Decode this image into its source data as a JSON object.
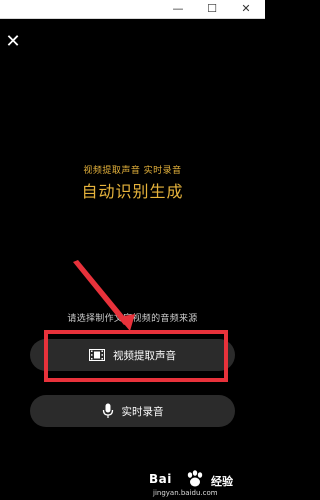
{
  "titlebar": {
    "minimize_glyph": "—",
    "maximize_glyph": "☐",
    "close_glyph": "✕"
  },
  "close_button": {
    "glyph": "✕"
  },
  "heading": {
    "small": "视频提取声音 实时录音",
    "large": "自动识别生成"
  },
  "subtitle": "请选择制作文字视频的音频来源",
  "buttons": [
    {
      "label": "视频提取声音",
      "icon": "film-icon"
    },
    {
      "label": "实时录音",
      "icon": "microphone-icon"
    }
  ],
  "colors": {
    "accent": "#e6b33c",
    "highlight": "#e8323b",
    "button_bg": "#2b2b2b"
  },
  "watermark": {
    "logo_text": "Bai",
    "logo_cn": "经验",
    "url": "jingyan.baidu.com"
  }
}
